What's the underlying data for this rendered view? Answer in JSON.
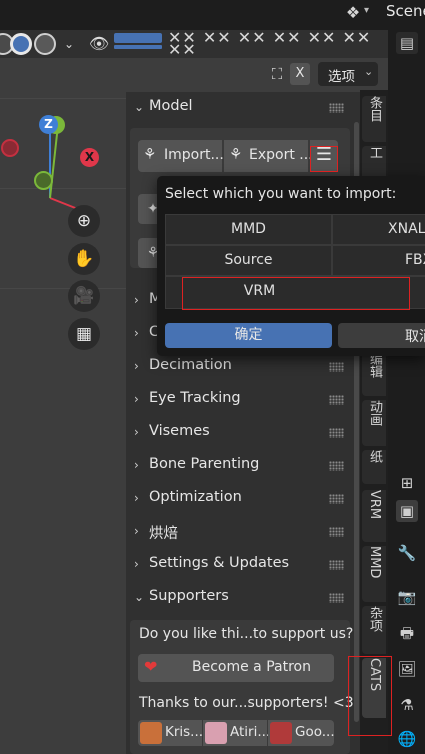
{
  "topbar": {
    "scene_label": "Scene"
  },
  "viewport_header": {
    "options_label": "选项",
    "x_label": "X",
    "icons": [
      "wireframe-shading-icon",
      "solid-shading-icon",
      "material-shading-icon",
      "chevron-down-icon",
      "visibility-eye-icon",
      "gizmo-icon"
    ]
  },
  "gizmo": {
    "z_label": "Z",
    "x_label": "X"
  },
  "panel": {
    "model_section": "Model",
    "import_label": "Import...",
    "export_label": "Export ...",
    "sections": [
      {
        "label": "M",
        "expanded": false
      },
      {
        "label": "C",
        "expanded": false
      },
      {
        "label": "Decimation",
        "expanded": false
      },
      {
        "label": "Eye Tracking",
        "expanded": false
      },
      {
        "label": "Visemes",
        "expanded": false
      },
      {
        "label": "Bone Parenting",
        "expanded": false
      },
      {
        "label": "Optimization",
        "expanded": false
      },
      {
        "label": "烘焙",
        "expanded": false
      },
      {
        "label": "Settings & Updates",
        "expanded": false
      },
      {
        "label": "Supporters",
        "expanded": true
      }
    ],
    "supporters": {
      "question": "Do you like thi...to support us?",
      "patron_button": "Become a Patron",
      "thanks": "Thanks to our...supporters! <3",
      "names": [
        "Kris...",
        "Atiri...",
        "Goo..."
      ]
    }
  },
  "tabs": [
    "条目",
    "工",
    "编辑",
    "动画",
    "纸",
    "VRM",
    "MMD",
    "杂项",
    "CATS"
  ],
  "popup": {
    "title": "Select which you want to import:",
    "options": [
      "MMD",
      "XNALa",
      "Source",
      "FBX",
      "VRM"
    ],
    "ok_label": "确定",
    "cancel_label": "取消"
  },
  "colors": {
    "accent_blue": "#4772b3",
    "highlight_red": "#dd2222",
    "axis_z": "#3f7fd6",
    "axis_x": "#e0374a",
    "axis_y": "#7bb83a"
  }
}
